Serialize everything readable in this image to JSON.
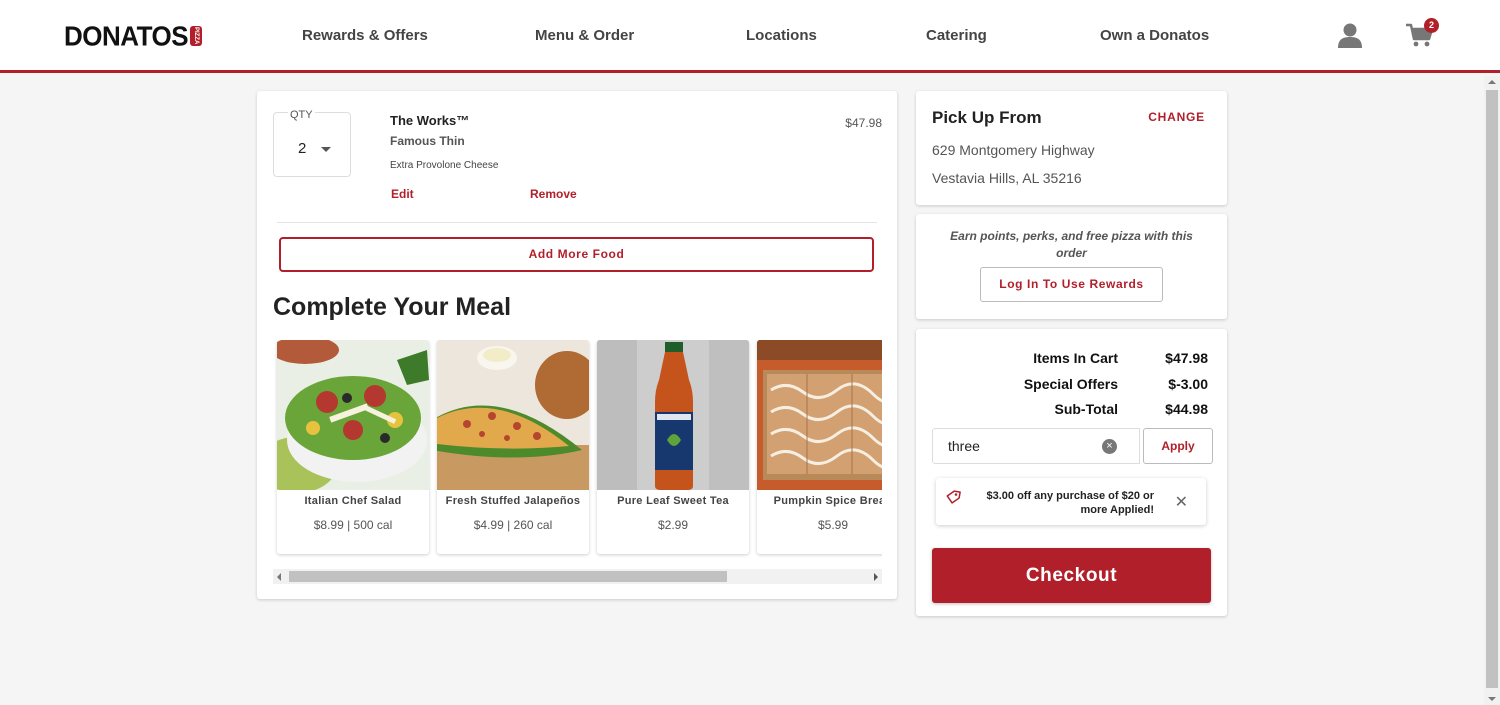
{
  "header": {
    "logo_text": "DONATOS",
    "logo_badge": "PIZZA",
    "nav": [
      "Rewards & Offers",
      "Menu & Order",
      "Locations",
      "Catering",
      "Own a Donatos"
    ],
    "cart_count": "2",
    "icons": {
      "account": "user-icon",
      "cart": "cart-icon"
    }
  },
  "cart_item": {
    "qty_label": "QTY",
    "qty_value": "2",
    "name": "The Works™",
    "crust": "Famous Thin",
    "topping": "Extra Provolone Cheese",
    "edit_label": "Edit",
    "remove_label": "Remove",
    "price": "$47.98"
  },
  "add_more_label": "Add More Food",
  "complete_meal": {
    "title": "Complete Your Meal",
    "products": [
      {
        "name": "Italian Chef Salad",
        "meta": "$8.99 | 500 cal"
      },
      {
        "name": "Fresh Stuffed Jalapeños",
        "meta": "$4.99 | 260 cal"
      },
      {
        "name": "Pure Leaf Sweet Tea",
        "meta": "$2.99"
      },
      {
        "name": "Pumpkin Spice Bread",
        "meta": "$5.99"
      }
    ]
  },
  "pickup": {
    "title": "Pick Up From",
    "change_label": "CHANGE",
    "address_line1": "629 Montgomery Highway",
    "address_line2": "Vestavia Hills, AL 35216"
  },
  "rewards": {
    "text": "Earn points, perks, and free pizza with this order",
    "button_label": "Log In To Use Rewards"
  },
  "summary": {
    "items_label": "Items In Cart",
    "items_value": "$47.98",
    "offers_label": "Special Offers",
    "offers_value": "$-3.00",
    "subtotal_label": "Sub-Total",
    "subtotal_value": "$44.98"
  },
  "promo": {
    "value": "three",
    "apply_label": "Apply",
    "applied_text": "$3.00 off any purchase of $20 or more Applied!"
  },
  "checkout_label": "Checkout",
  "colors": {
    "brand": "#b11f2a",
    "background": "#f5f5f5"
  }
}
